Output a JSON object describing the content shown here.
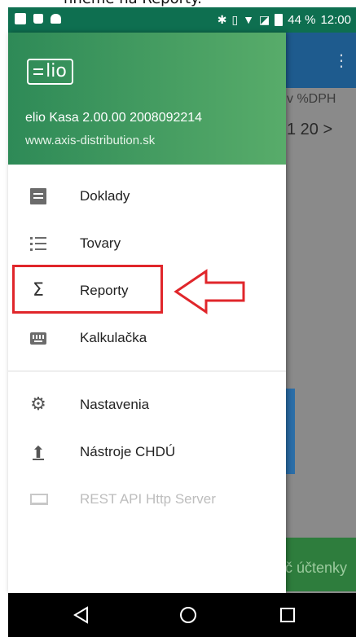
{
  "caption": {
    "text": "hneme na Reporty."
  },
  "status_bar": {
    "battery_text": "44 %",
    "time": "12:00",
    "icons": [
      "print-icon",
      "lock-icon",
      "android-icon",
      "bluetooth-icon",
      "vibrate-icon",
      "wifi-icon",
      "no-sim-icon",
      "battery-icon"
    ]
  },
  "background_app": {
    "header_text": "v %DPH",
    "row_text": "1   20 >",
    "bottom_button_text": "č účtenky",
    "menu_icon": "more-vert-icon"
  },
  "drawer": {
    "logo_text": "lio",
    "app_version": "elio Kasa 2.00.00 2008092214",
    "website": "www.axis-distribution.sk",
    "items": [
      {
        "label": "Doklady",
        "icon": "receipt-icon"
      },
      {
        "label": "Tovary",
        "icon": "list-icon"
      },
      {
        "label": "Reporty",
        "icon": "sigma-icon"
      },
      {
        "label": "Kalkulačka",
        "icon": "keyboard-icon"
      },
      {
        "label": "Nastavenia",
        "icon": "gear-icon"
      },
      {
        "label": "Nástroje CHDÚ",
        "icon": "upload-icon"
      },
      {
        "label": "REST API Http Server",
        "icon": "laptop-icon",
        "disabled": true
      }
    ]
  },
  "annotation": {
    "highlight_color": "#e0262b",
    "target": "Reporty"
  },
  "colors": {
    "status_bar": "#0e6f50",
    "drawer_header_start": "#2e8a57",
    "drawer_header_end": "#58ac6a",
    "app_toolbar": "#1e5b8e"
  },
  "nav_bar": {
    "buttons": [
      "back-icon",
      "home-icon",
      "recents-icon"
    ]
  }
}
